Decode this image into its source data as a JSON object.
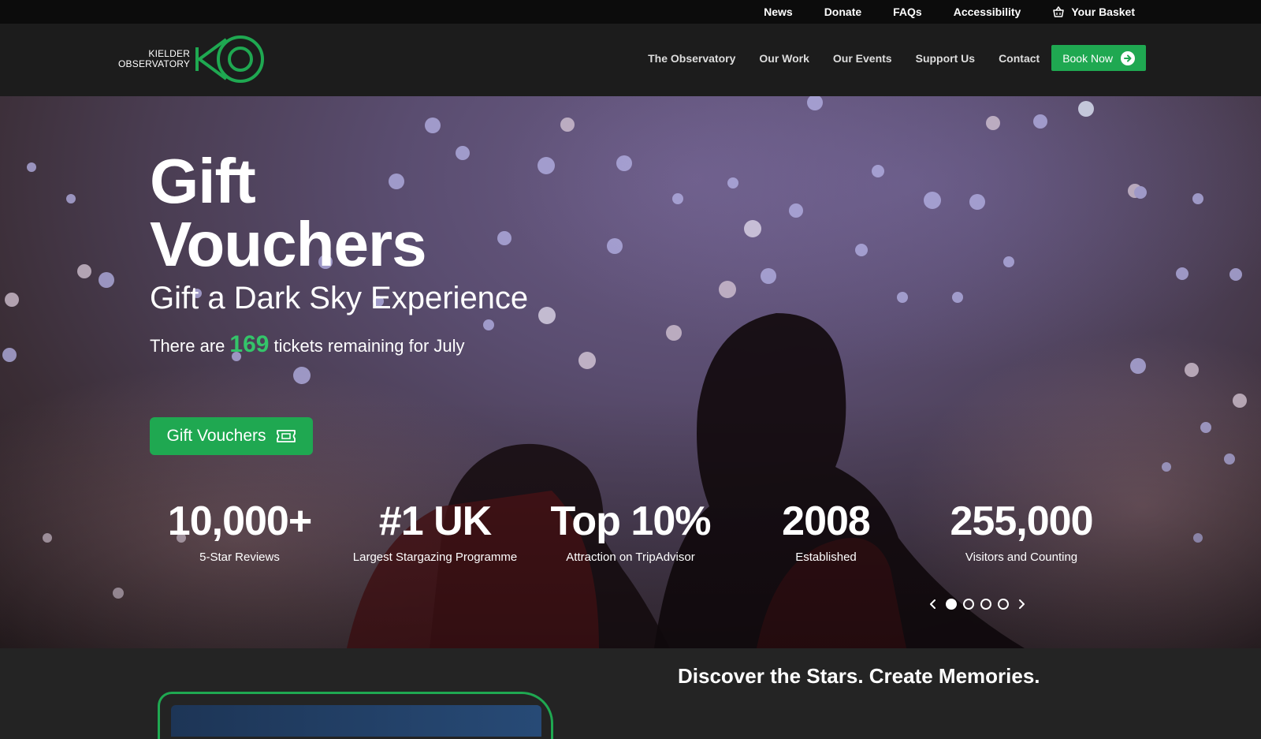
{
  "utility_bar": {
    "links": [
      "News",
      "Donate",
      "FAQs",
      "Accessibility"
    ],
    "basket_label": "Your Basket",
    "basket_icon": "basket-icon"
  },
  "header": {
    "logo_line1": "KIELDER",
    "logo_line2": "OBSERVATORY",
    "nav": [
      "The Observatory",
      "Our Work",
      "Our Events",
      "Support Us",
      "Contact"
    ],
    "book_label": "Book Now",
    "book_icon": "arrow-circle-right-icon"
  },
  "hero": {
    "title_line1": "Gift",
    "title_line2": "Vouchers",
    "subtitle": "Gift a Dark Sky Experience",
    "tickets_prefix": "There are",
    "tickets_count": "169",
    "tickets_suffix": "tickets remaining for July",
    "cta_label": "Gift Vouchers",
    "cta_icon": "ticket-icon",
    "stats": [
      {
        "value": "10,000+",
        "label": "5-Star Reviews"
      },
      {
        "value": "#1 UK",
        "label": "Largest Stargazing Programme"
      },
      {
        "value": "Top 10%",
        "label": "Attraction on TripAdvisor"
      },
      {
        "value": "2008",
        "label": "Established"
      },
      {
        "value": "255,000",
        "label": "Visitors and Counting"
      }
    ],
    "carousel": {
      "slides": 4,
      "active": 1
    }
  },
  "below": {
    "heading": "Discover the Stars. Create Memories."
  },
  "colors": {
    "accent": "#1fa851",
    "accent_text": "#34c46a",
    "top_bar": "#0c0c0c",
    "nav_bg": "#1c1c1c"
  }
}
